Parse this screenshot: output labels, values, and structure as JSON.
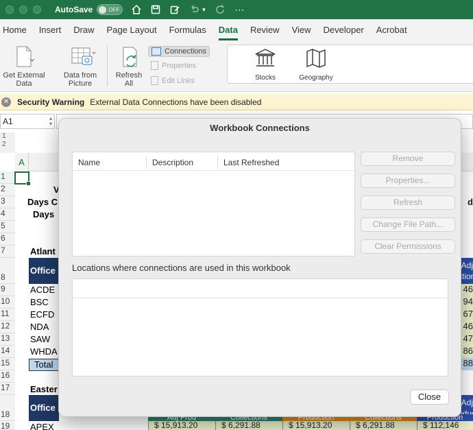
{
  "titlebar": {
    "autosave_label": "AutoSave",
    "toggle_label": "OFF"
  },
  "tabs": [
    "Home",
    "Insert",
    "Draw",
    "Page Layout",
    "Formulas",
    "Data",
    "Review",
    "View",
    "Developer",
    "Acrobat"
  ],
  "active_tab": "Data",
  "ribbon": {
    "get_external_data": "Get External Data",
    "data_from_picture": "Data from Picture",
    "refresh_all": "Refresh All",
    "connections": "Connections",
    "properties": "Properties",
    "edit_links": "Edit Links",
    "stocks": "Stocks",
    "geography": "Geography"
  },
  "security": {
    "title": "Security Warning",
    "message": "External Data Connections have been disabled"
  },
  "namebox": "A1",
  "outline_levels": [
    "1",
    "2"
  ],
  "sheet": {
    "column_a": "A",
    "rows": [
      "1",
      "2",
      "3",
      "4",
      "5",
      "6",
      "7",
      "8",
      "9",
      "10",
      "11",
      "12",
      "13",
      "14",
      "15",
      "16",
      "17",
      "18",
      "19"
    ],
    "cells": {
      "r2": "V",
      "r3": "Days C",
      "r4": "Days",
      "r7": "Atlant",
      "r8": "Office",
      "r9": "ACDE",
      "r10": "BSC",
      "r11": "ECFD",
      "r12": "NDA",
      "r13": "SAW",
      "r14": "WHDA",
      "r15": "Total",
      "r17": "Easter",
      "r18": "Office",
      "r19": "APEX"
    },
    "right_col": {
      "r3": "d",
      "r8a": "Adj",
      "r8b": "ction",
      "r9": "46",
      "r10": "94",
      "r11": "67",
      "r12": "46",
      "r13": "47",
      "r14": "86",
      "r15": "88",
      "r18a": "Adj",
      "r18b": "oductio"
    },
    "bottom_headers": [
      "Adj Prod",
      "Collections",
      "Production",
      "Collections",
      "Production"
    ],
    "bottom_values": [
      "$   15,913.20",
      "$     6,291.88",
      "$   15,913.20",
      "$     6,291.88",
      "$   112,146"
    ]
  },
  "dialog": {
    "title": "Workbook Connections",
    "columns": [
      "Name",
      "Description",
      "Last Refreshed"
    ],
    "buttons": [
      "Remove",
      "Properties...",
      "Refresh",
      "Change File Path...",
      "Clear Permissions"
    ],
    "locations_label": "Locations where connections are used in this workbook",
    "close_label": "Close"
  },
  "colors": {
    "excel_green": "#217346",
    "office_header": "#1f3864",
    "total_fill": "#bdd7ee",
    "warning_bar": "#fdf5d2"
  }
}
